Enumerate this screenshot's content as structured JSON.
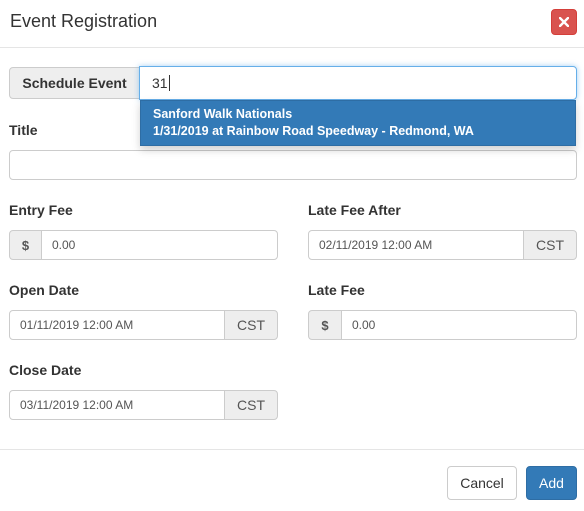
{
  "modal": {
    "title": "Event Registration",
    "close_icon": "close-icon"
  },
  "schedule_event": {
    "label": "Schedule Event",
    "value": "31",
    "suggestion": {
      "name": "Sanford Walk Nationals",
      "details": "1/31/2019 at Rainbow Road Speedway - Redmond, WA"
    }
  },
  "title_field": {
    "label": "Title",
    "value": ""
  },
  "entry_fee": {
    "label": "Entry Fee",
    "prefix": "$",
    "value": "0.00"
  },
  "late_fee_after": {
    "label": "Late Fee After",
    "value": "02/11/2019 12:00 AM",
    "tz": "CST"
  },
  "open_date": {
    "label": "Open Date",
    "value": "01/11/2019 12:00 AM",
    "tz": "CST"
  },
  "late_fee": {
    "label": "Late Fee",
    "prefix": "$",
    "value": "0.00"
  },
  "close_date": {
    "label": "Close Date",
    "value": "03/11/2019 12:00 AM",
    "tz": "CST"
  },
  "footer": {
    "cancel_label": "Cancel",
    "add_label": "Add"
  },
  "colors": {
    "primary": "#337ab7",
    "danger": "#d9534f",
    "focus_border": "#66afe9"
  }
}
